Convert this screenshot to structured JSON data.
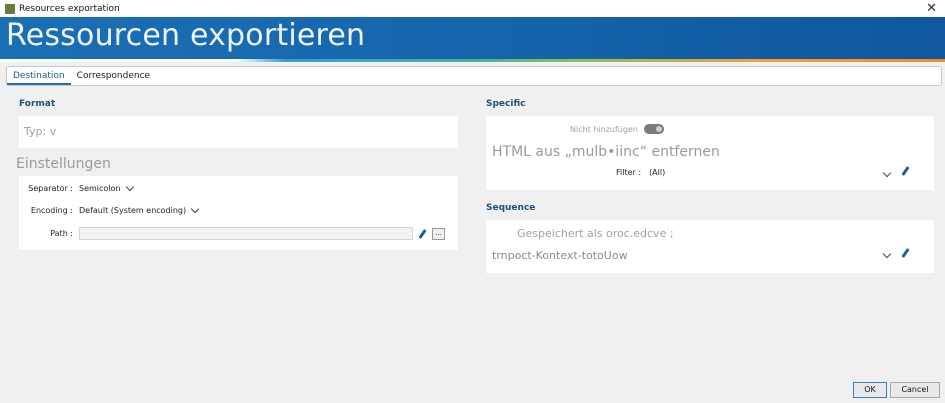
{
  "window": {
    "title": "Resources exportation",
    "close_label": "✕"
  },
  "banner": {
    "title": "Ressourcen exportieren"
  },
  "tabs": [
    {
      "label": "Destination"
    },
    {
      "label": "Correspondence"
    }
  ],
  "left": {
    "format_title": "Format",
    "format_type": "Typ: v",
    "settings_title": "Einstellungen",
    "separator_label": "Separator :",
    "separator_value": "Semicolon",
    "encoding_label": "Encoding :",
    "encoding_value": "Default (System encoding)",
    "path_label": "Path :",
    "path_value": "",
    "browse_label": "..."
  },
  "right": {
    "specific_title": "Specific",
    "toggle_label": "Nicht hinzufügen",
    "html_text": "HTML aus „mulb•iinc“ entfernen",
    "filter_label": "Filter :",
    "filter_value": "(All)",
    "sequence_title": "Sequence",
    "saved_as": "Gespeichert als oroc.edcve ;",
    "context_value": "trnpoct-Kontext-totoUow"
  },
  "buttons": {
    "ok": "OK",
    "cancel": "Cancel"
  },
  "colors": {
    "banner": "#1565ad",
    "accent": "#1b6fb5",
    "section_title": "#1d4f7c"
  }
}
